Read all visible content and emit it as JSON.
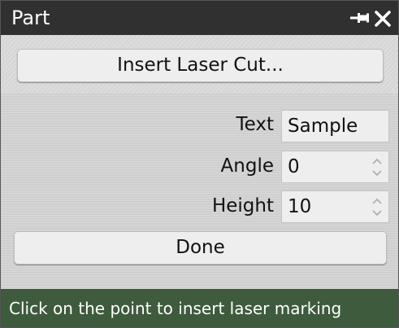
{
  "window": {
    "title": "Part"
  },
  "titlebar": {
    "icons": [
      "pin-icon",
      "close-icon"
    ]
  },
  "actions": {
    "insert_label": "Insert Laser Cut...",
    "done_label": "Done"
  },
  "fields": {
    "text": {
      "label": "Text",
      "value": "Sample"
    },
    "angle": {
      "label": "Angle",
      "value": "0"
    },
    "height": {
      "label": "Height",
      "value": "10"
    }
  },
  "status": {
    "message": "Click on the point to insert laser marking",
    "color": "#3e5b3d"
  },
  "colors": {
    "titlebar": "#303030",
    "panel": "#d9d9d9",
    "button": "#eeeeee"
  }
}
